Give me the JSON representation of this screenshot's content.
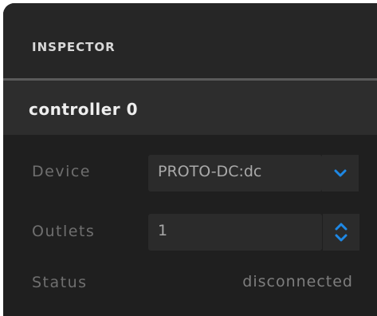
{
  "inspector": {
    "title": "INSPECTOR",
    "object_name": "controller 0",
    "device": {
      "label": "Device",
      "value": "PROTO-DC:dc",
      "icon": "chevron-down-icon"
    },
    "outlets": {
      "label": "Outlets",
      "value": "1",
      "icon": "stepper-icon"
    },
    "status": {
      "label": "Status",
      "value": "disconnected"
    }
  },
  "colors": {
    "accent": "#1e88e5",
    "panel": "#1f1f1f",
    "header": "#262626",
    "field": "#2b2b2b"
  }
}
